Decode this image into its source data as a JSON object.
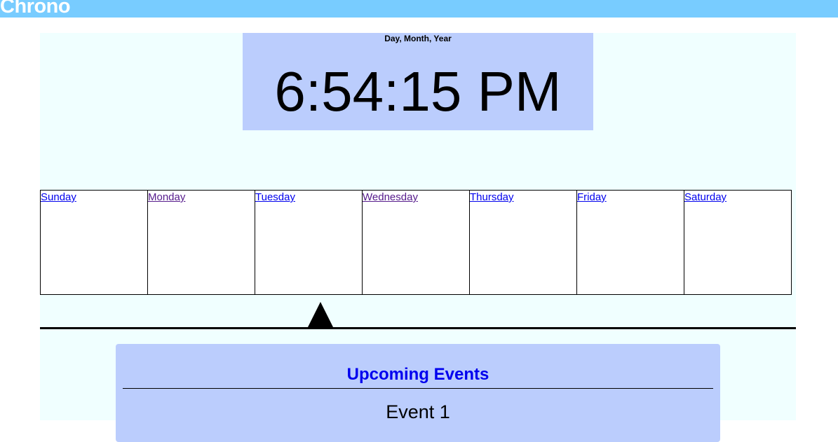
{
  "header": {
    "brand": "Chrono",
    "color": "#78ccff"
  },
  "clock": {
    "date_label": "Day, Month, Year",
    "time": "6:54:15 PM",
    "background": "#bbcdfd"
  },
  "week": {
    "days": [
      {
        "label": "Sunday",
        "visited": false
      },
      {
        "label": "Monday",
        "visited": true
      },
      {
        "label": "Tuesday",
        "visited": false
      },
      {
        "label": "Wednesday",
        "visited": true
      },
      {
        "label": "Thursday",
        "visited": false
      },
      {
        "label": "Friday",
        "visited": false
      },
      {
        "label": "Saturday",
        "visited": false
      }
    ],
    "current_day_indicator": "Tuesday"
  },
  "events": {
    "title": "Upcoming Events",
    "items": [
      "Event 1"
    ]
  },
  "colors": {
    "page_background": "#f0ffff",
    "link": "#0000ee",
    "link_visited": "#551a8b"
  }
}
